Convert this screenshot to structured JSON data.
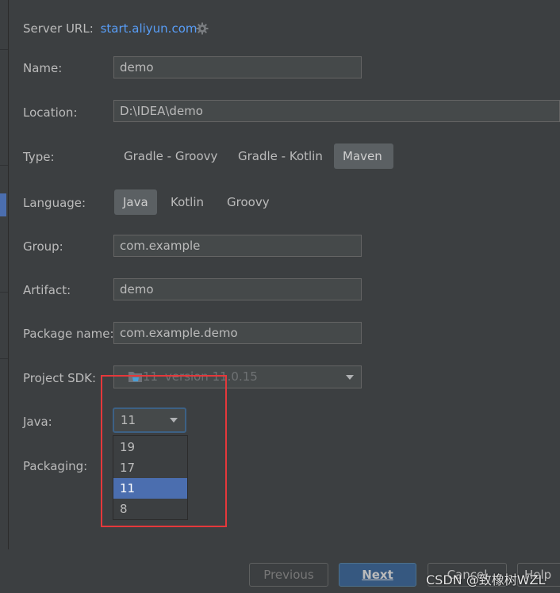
{
  "server": {
    "label": "Server URL:",
    "url": "start.aliyun.com",
    "settings_icon": "gear-icon"
  },
  "form": {
    "name": {
      "label": "Name:",
      "value": "demo"
    },
    "location": {
      "label": "Location:",
      "value": "D:\\IDEA\\demo"
    },
    "type": {
      "label": "Type:",
      "options": [
        "Gradle - Groovy",
        "Gradle - Kotlin",
        "Maven"
      ],
      "selected": "Maven"
    },
    "language": {
      "label": "Language:",
      "options": [
        "Java",
        "Kotlin",
        "Groovy"
      ],
      "selected": "Java"
    },
    "group": {
      "label": "Group:",
      "value": "com.example"
    },
    "artifact": {
      "label": "Artifact:",
      "value": "demo"
    },
    "package_name": {
      "label": "Package name:",
      "value": "com.example.demo"
    },
    "project_sdk": {
      "label": "Project SDK:",
      "value_version": "11",
      "value_detail": "version 11.0.15"
    },
    "java": {
      "label": "Java:",
      "value": "11",
      "options": [
        "19",
        "17",
        "11",
        "8"
      ],
      "selected": "11"
    },
    "packaging": {
      "label": "Packaging:"
    }
  },
  "buttons": {
    "previous": "Previous",
    "next": "Next",
    "cancel": "Cancel",
    "help": "Help"
  },
  "watermark": "CSDN @致橡树WZL",
  "colors": {
    "accent": "#4b6eaf",
    "link": "#589df6",
    "highlight": "#e5383b"
  }
}
